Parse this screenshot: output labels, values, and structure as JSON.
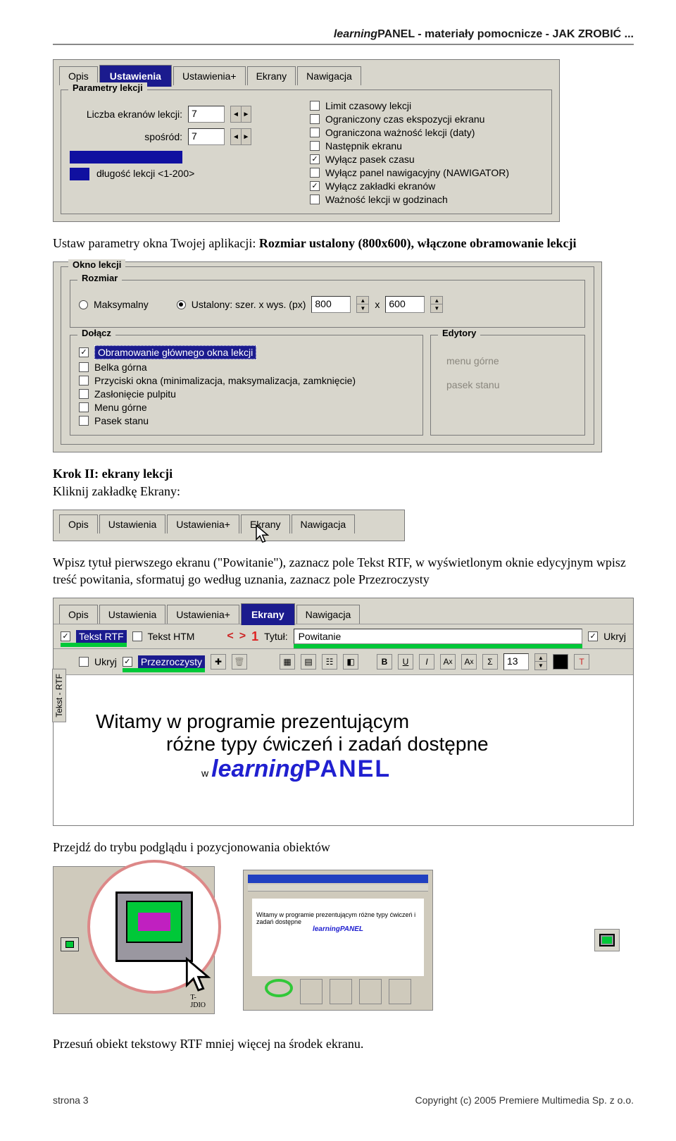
{
  "header": {
    "brand_ital": "learning",
    "brand_bold": "PANEL",
    "suffix": " - materiały pomocnicze - JAK ZROBIĆ ..."
  },
  "shot1": {
    "tabs": [
      "Opis",
      "Ustawienia",
      "Ustawienia+",
      "Ekrany",
      "Nawigacja"
    ],
    "active_tab": 1,
    "group": "Parametry lekcji",
    "row1_label": "Liczba ekranów lekcji:",
    "row1_val": "7",
    "row2_label": "spośród:",
    "row2_val": "7",
    "hint": "długość lekcji <1-200>",
    "right_opts": [
      {
        "label": "Limit czasowy lekcji",
        "checked": false
      },
      {
        "label": "Ograniczony czas ekspozycji ekranu",
        "checked": false
      },
      {
        "label": "Ograniczona ważność lekcji (daty)",
        "checked": false
      },
      {
        "label": "Następnik ekranu",
        "checked": false
      },
      {
        "label": "Wyłącz pasek czasu",
        "checked": true
      },
      {
        "label": "Wyłącz panel nawigacyjny (NAWIGATOR)",
        "checked": false
      },
      {
        "label": "Wyłącz zakładki ekranów",
        "checked": true
      },
      {
        "label": "Ważność lekcji w godzinach",
        "checked": false
      }
    ]
  },
  "para1_a": "Ustaw parametry okna Twojej aplikacji: ",
  "para1_b": "Rozmiar ustalony (800x600), włączone obramowanie lekcji",
  "shot2": {
    "group": "Okno lekcji",
    "sub_rozmiar": "Rozmiar",
    "radio_max": "Maksymalny",
    "radio_ustal": "Ustalony: szer. x wys. (px)",
    "szer": "800",
    "wys": "600",
    "x": "x",
    "sub_dolacz": "Dołącz",
    "dolacz": [
      {
        "label": "Obramowanie głównego okna lekcji",
        "checked": true,
        "sel": true
      },
      {
        "label": "Belka górna",
        "checked": false
      },
      {
        "label": "Przyciski okna (minimalizacja, maksymalizacja, zamknięcie)",
        "checked": false
      },
      {
        "label": "Zasłonięcie pulpitu",
        "checked": false
      },
      {
        "label": "Menu górne",
        "checked": false
      },
      {
        "label": "Pasek stanu",
        "checked": false
      }
    ],
    "sub_edytory": "Edytory",
    "ed1": "menu górne",
    "ed2": "pasek stanu"
  },
  "krok2_head": "Krok II: ekrany lekcji",
  "krok2_sub": "Kliknij zakładkę Ekrany:",
  "shot_tabs2": {
    "tabs": [
      "Opis",
      "Ustawienia",
      "Ustawienia+",
      "Ekrany",
      "Nawigacja"
    ],
    "cursor_under": 3
  },
  "para2": "Wpisz tytuł pierwszego ekranu (\"Powitanie\"), zaznacz pole Tekst RTF, w wyświetlonym oknie edycyjnym wpisz treść powitania, sformatuj go według uznania, zaznacz pole Przezroczysty",
  "shot3": {
    "tabs": [
      "Opis",
      "Ustawienia",
      "Ustawienia+",
      "Ekrany",
      "Nawigacja"
    ],
    "active_tab": 3,
    "row_a": {
      "tekstrtf": "Tekst RTF",
      "teksthtm": "Tekst HTM",
      "nav_l": "<",
      "nav_r": ">",
      "num": "1",
      "title_label": "Tytuł:",
      "title_val": "Powitanie",
      "ukryj": "Ukryj"
    },
    "row_b": {
      "ukryj": "Ukryj",
      "przez": "Przezroczysty",
      "font_size": "13"
    },
    "sidetab": "Tekst - RTF",
    "canvas": {
      "l1": "Witamy w programie prezentującym",
      "l2": "różne typy ćwiczeń i zadań dostępne",
      "l3_small": "w",
      "l3_ital": "learning",
      "l3_panel": "PANEL"
    }
  },
  "para3": "Przejdź do trybu podglądu i pozycjonowania obiektów",
  "thumb_b_title": "Witamy w programie prezentującym różne typy ćwiczeń i zadań dostępne",
  "thumb_b_brand": "learningPANEL",
  "thumb_a_footers": [
    "T-",
    "JDIO"
  ],
  "para4": "Przesuń obiekt tekstowy RTF mniej więcej na środek ekranu.",
  "footer": {
    "left": "strona 3",
    "right": "Copyright (c) 2005 Premiere Multimedia Sp. z o.o."
  }
}
